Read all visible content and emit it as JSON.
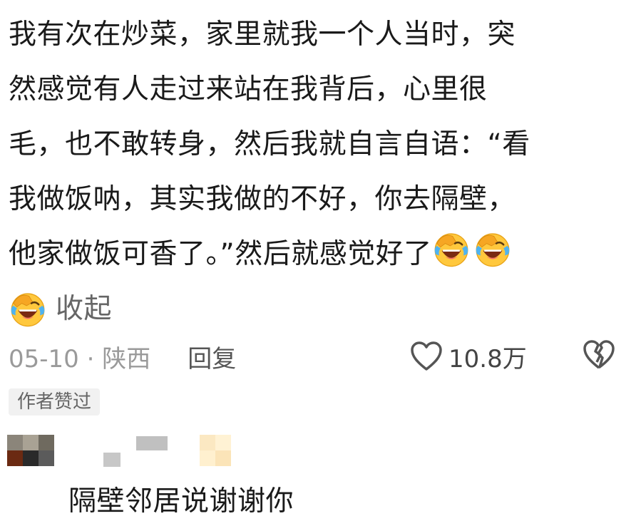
{
  "comment": {
    "lines": [
      "我有次在炒菜，家里就我一个人当时，突",
      "然感觉有人走过来站在我背后，心里很",
      "毛，也不敢转身，然后我就自言自语：“看",
      "我做饭呐，其实我做的不好，你去隔壁，",
      "他家做饭可香了。”然后就感觉好了"
    ],
    "emoji_name": "laughing-tears-emoji",
    "collapse_label": "收起"
  },
  "meta": {
    "date_location": "05-10 · 陕西",
    "reply_label": "回复",
    "like_count": "10.8万",
    "like_icon": "heart-outline-icon",
    "dislike_icon": "broken-heart-icon"
  },
  "badge": {
    "label": "作者赞过"
  },
  "reply": {
    "text": "隔壁邻居说谢谢你"
  },
  "colors": {
    "emoji_face": "#FFC83D",
    "emoji_hand": "#F6A623",
    "emoji_mouth": "#7A2A12",
    "emoji_tear": "#4FB3F0",
    "muted_text": "#999999",
    "badge_bg": "#F1F1F1"
  }
}
